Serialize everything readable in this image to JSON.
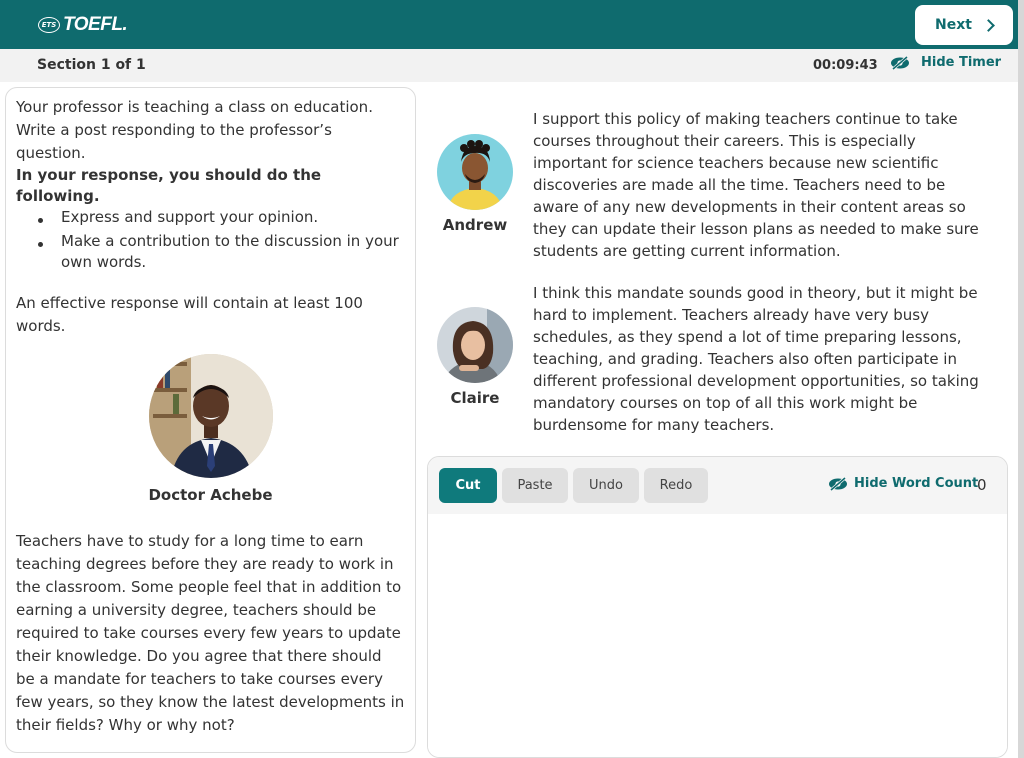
{
  "header": {
    "logo_mark": "ETS",
    "logo_text": "TOEFL.",
    "next_label": "Next"
  },
  "section_bar": {
    "section_label": "Section 1 of 1",
    "timer": "00:09:43",
    "hide_timer_label": "Hide Timer"
  },
  "prompt": {
    "intro": "Your professor is teaching a class on education. Write a post responding to the professor’s question.",
    "instructions_heading": "In your response, you should do the following.",
    "bullets": [
      "Express and support your opinion.",
      "Make a contribution to the discussion in your own words."
    ],
    "effective": "An effective response will contain at least 100 words.",
    "professor_name": "Doctor Achebe",
    "professor_question": "Teachers have to study for a long time to earn teaching degrees before they are ready to work in the classroom. Some people feel that in addition to earning a university degree, teachers should be required to take courses every few years to update their knowledge. Do you agree that there should be a mandate for teachers to take courses every few years, so they know the latest developments in their fields? Why or why not?"
  },
  "students": [
    {
      "name": "Andrew",
      "post": "I support this policy of making teachers continue to take courses throughout their careers. This is especially important for science teachers because new scientific discoveries are made all the time. Teachers need to be aware of any new developments in their content areas so they can update their lesson plans as needed to make sure students are getting current information."
    },
    {
      "name": "Claire",
      "post": "I think this mandate sounds good in theory, but it might be hard to implement. Teachers already have very busy schedules, as they spend a lot of time preparing lessons, teaching, and grading. Teachers also often participate in different professional development opportunities, so taking mandatory courses on top of all this work might be burdensome for many teachers."
    }
  ],
  "editor": {
    "buttons": [
      "Cut",
      "Paste",
      "Undo",
      "Redo"
    ],
    "active_button": "Cut",
    "hide_word_count_label": "Hide Word Count",
    "word_count": "0",
    "value": ""
  },
  "colors": {
    "brand": "#0f6b6e",
    "active_button": "#0f7a7c"
  }
}
